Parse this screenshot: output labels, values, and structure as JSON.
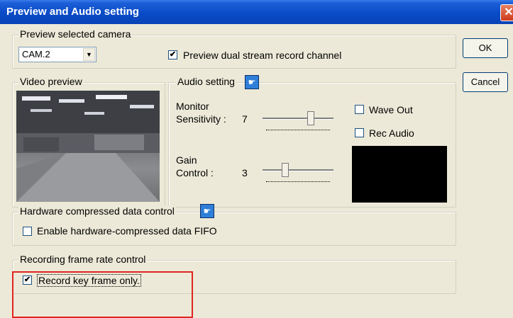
{
  "window": {
    "title": "Preview and Audio setting",
    "close_glyph": "✕"
  },
  "buttons": {
    "ok": "OK",
    "cancel": "Cancel"
  },
  "preview_group": {
    "legend": "Preview selected camera",
    "camera_select": {
      "selected": "CAM.2",
      "arrow": "▼"
    },
    "dual_stream": {
      "label": "Preview dual stream record channel",
      "checked": true
    }
  },
  "video_group": {
    "legend": "Video preview"
  },
  "audio_group": {
    "legend": "Audio setting",
    "icon": "hand-pointer-icon",
    "monitor": {
      "label_line1": "Monitor",
      "label_line2": "Sensitivity :",
      "value": "7",
      "level": 7,
      "max": 10
    },
    "gain": {
      "label_line1": "Gain",
      "label_line2": "Control :",
      "value": "3",
      "level": 3,
      "max": 10
    },
    "wave_out": {
      "label": "Wave Out",
      "checked": false
    },
    "rec_audio": {
      "label": "Rec Audio",
      "checked": false
    }
  },
  "hardware_group": {
    "legend": "Hardware compressed data control",
    "icon": "hand-pointer-icon",
    "fifo": {
      "label": "Enable hardware-compressed data FIFO",
      "checked": false
    }
  },
  "frame_rate_group": {
    "legend": "Recording frame rate control",
    "keyframe": {
      "label": "Record key frame only.",
      "checked": true
    }
  },
  "check_glyph": "✔",
  "hand_glyph": "☛",
  "colors": {
    "title_bar": "#0a4bc8",
    "highlight_box": "#e0251f",
    "dialog_bg": "#ece9d8"
  }
}
